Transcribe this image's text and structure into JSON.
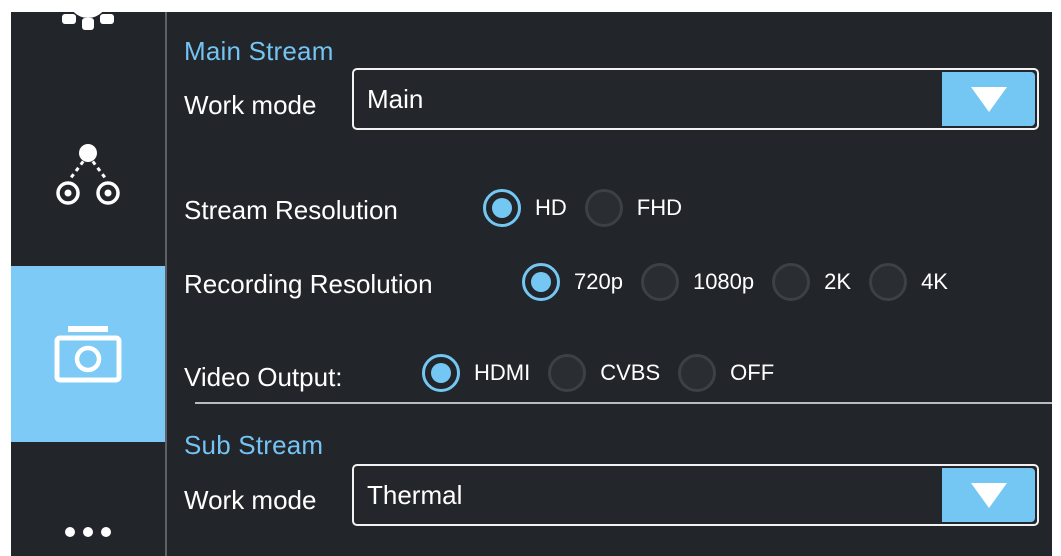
{
  "colors": {
    "accent": "#75c7f3",
    "background": "#22252a",
    "text": "#ffffff"
  },
  "sidebar": {
    "items": [
      {
        "icon": "gear-icon",
        "active": false
      },
      {
        "icon": "node-graph-icon",
        "active": false
      },
      {
        "icon": "camera-icon",
        "active": true
      },
      {
        "icon": "more-icon",
        "active": false
      }
    ]
  },
  "main_stream": {
    "title": "Main Stream",
    "work_mode_label": "Work mode",
    "work_mode_value": "Main",
    "stream_resolution": {
      "label": "Stream Resolution",
      "options": [
        "HD",
        "FHD"
      ],
      "selected": "HD"
    },
    "recording_resolution": {
      "label": "Recording Resolution",
      "options": [
        "720p",
        "1080p",
        "2K",
        "4K"
      ],
      "selected": "720p"
    },
    "video_output": {
      "label": "Video Output:",
      "options": [
        "HDMI",
        "CVBS",
        "OFF"
      ],
      "selected": "HDMI"
    }
  },
  "sub_stream": {
    "title": "Sub Stream",
    "work_mode_label": "Work mode",
    "work_mode_value": "Thermal"
  }
}
